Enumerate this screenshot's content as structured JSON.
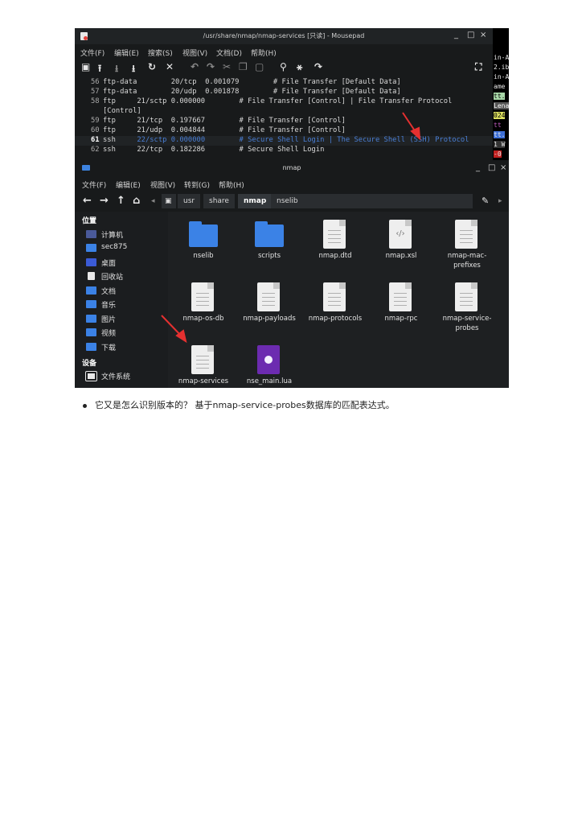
{
  "mousepad": {
    "title": "/usr/share/nmap/nmap-services [只读] - Mousepad",
    "menus": [
      "文件(F)",
      "编辑(E)",
      "搜索(S)",
      "视图(V)",
      "文档(D)",
      "帮助(H)"
    ],
    "controls": {
      "minimize": "_",
      "maximize": "□",
      "close": "×"
    },
    "lines": [
      {
        "no": "56",
        "text": "ftp-data        20/tcp  0.001079        # File Transfer [Default Data]"
      },
      {
        "no": "57",
        "text": "ftp-data        20/udp  0.001878        # File Transfer [Default Data]"
      },
      {
        "no": "58",
        "text": "ftp     21/sctp 0.000000        # File Transfer [Control] | File Transfer Protocol"
      },
      {
        "no": "",
        "text": "[Control]"
      },
      {
        "no": "59",
        "text": "ftp     21/tcp  0.197667        # File Transfer [Control]"
      },
      {
        "no": "60",
        "text": "ftp     21/udp  0.004844        # File Transfer [Control]"
      },
      {
        "no": "61",
        "text_a": "ssh     ",
        "text_b": "22/sctp 0.000000        # Secure Shell Login | The Secure Shell (SSH) Protocol"
      },
      {
        "no": "62",
        "text": "ssh     22/tcp  0.182286        # Secure Shell Login"
      }
    ],
    "side_strip": [
      "in-A",
      "2.ib",
      "in-A",
      "ame",
      "tt.",
      "Lena",
      "024",
      "tt",
      "tt.",
      "1 W",
      "-0"
    ]
  },
  "filemanager": {
    "title": "nmap",
    "menus": [
      "文件(F)",
      "编辑(E)",
      "视图(V)",
      "转到(G)",
      "帮助(H)"
    ],
    "controls": {
      "minimize": "_",
      "maximize": "□",
      "close": "×"
    },
    "breadcrumbs": [
      "usr",
      "share",
      "nmap",
      "nselib"
    ],
    "active_crumb": "nmap",
    "sidebar": {
      "places_heading": "位置",
      "places": [
        "计算机",
        "sec875",
        "桌面",
        "回收站",
        "文档",
        "音乐",
        "图片",
        "视频",
        "下载"
      ],
      "devices_heading": "设备",
      "devices": [
        "文件系统"
      ]
    },
    "files": [
      {
        "name": "nselib",
        "type": "folder"
      },
      {
        "name": "scripts",
        "type": "folder"
      },
      {
        "name": "nmap.dtd",
        "type": "text"
      },
      {
        "name": "nmap.xsl",
        "type": "code"
      },
      {
        "name": "nmap-mac-prefixes",
        "type": "text"
      },
      {
        "name": "nmap-os-db",
        "type": "text"
      },
      {
        "name": "nmap-payloads",
        "type": "text"
      },
      {
        "name": "nmap-protocols",
        "type": "text"
      },
      {
        "name": "nmap-rpc",
        "type": "text"
      },
      {
        "name": "nmap-service-probes",
        "type": "text"
      },
      {
        "name": "nmap-services",
        "type": "text"
      },
      {
        "name": "nse_main.lua",
        "type": "lua"
      }
    ]
  },
  "bullet_text": "它又是怎么识别版本的？ 基于nmap-service-probes数据库的匹配表达式。",
  "colors": {
    "arrow": "#e53030",
    "folder": "#3b82e6",
    "highlight_text": "#4a7fd6"
  }
}
